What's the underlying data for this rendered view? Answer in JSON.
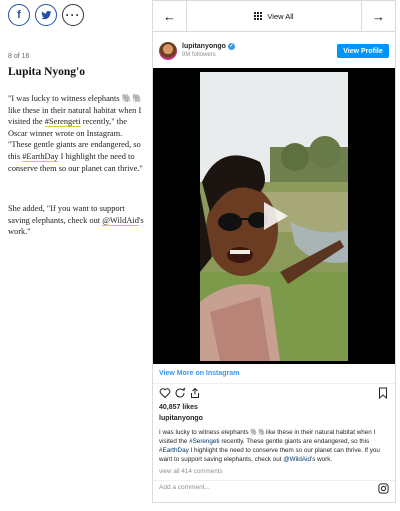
{
  "share": {
    "facebook_glyph": "f",
    "twitter_glyph": "🐦",
    "more_glyph": "···"
  },
  "article": {
    "counter": "8 of 16",
    "name": "Lupita Nyong'o",
    "para1_a": "\"I was lucky to witness elephants 🐘🐘 like these in their natural habitat when I visited the ",
    "para1_tag1": "#Serengeti",
    "para1_b": " recently,\" the Oscar winner wrote on Instagram. \"These gentle giants are endangered, so this ",
    "para1_tag2": "#EarthDay",
    "para1_c": " I highlight the need to conserve them so our planet can thrive.\"",
    "para2_a": "She added, \"If you want to support saving elephants, check out ",
    "para2_tag": "@WildAid",
    "para2_b": "'s work.\""
  },
  "embed": {
    "nav_left": "←",
    "nav_right": "→",
    "view_all": "View All",
    "username": "lupitanyongo",
    "verified_glyph": "✓",
    "followers": "9M followers",
    "view_profile": "View Profile",
    "view_more": "View More on Instagram",
    "likes": "40,857 likes",
    "caption_user": "lupitanyongo",
    "caption_a": "I was lucky to witness elephants 🐘🐘like these in their natural habitat when I visited the ",
    "caption_tag1": "#Serengeti",
    "caption_b": " recently. These gentle giants are endangered, so this ",
    "caption_tag2": "#EarthDay",
    "caption_c": " I highlight the need to conserve them so our planet can thrive. If you want to support saving elephants, check out ",
    "caption_tag3": "@WildAid",
    "caption_d": "'s work.",
    "comments": "view all 414 comments",
    "add_comment": "Add a comment..."
  },
  "colors": {
    "accent_blue": "#1f4fa6",
    "instagram_blue": "#0095f6",
    "link_underline": "#e3c14a"
  },
  "icons": [
    "facebook-icon",
    "twitter-icon",
    "more-icon",
    "arrow-left-icon",
    "grid-icon",
    "arrow-right-icon",
    "verified-icon",
    "play-icon",
    "heart-icon",
    "comment-icon",
    "share-icon",
    "bookmark-icon",
    "instagram-icon"
  ]
}
